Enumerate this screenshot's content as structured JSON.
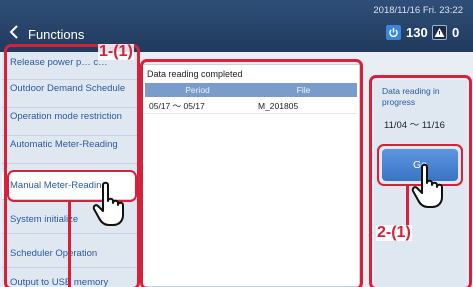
{
  "header": {
    "title": "Functions",
    "datetime": "2018/11/16 Fri. 23:22",
    "stats": [
      {
        "icon": "power-icon",
        "value": "130"
      },
      {
        "icon": "warning-icon",
        "value": "0"
      }
    ]
  },
  "sidebar": {
    "items": [
      {
        "label": "Release power p… c…"
      },
      {
        "label": "Outdoor Demand Schedule"
      },
      {
        "label": "Operation mode restriction"
      },
      {
        "label": "Automatic Meter-Reading"
      },
      {
        "label": "Manual Meter-Reading"
      },
      {
        "label": "System initialize"
      },
      {
        "label": "Scheduler Operation"
      },
      {
        "label": "Output to USB memory"
      }
    ]
  },
  "main": {
    "status": "Data reading completed",
    "columns": [
      "Period",
      "File"
    ],
    "rows": [
      {
        "period": "05/17 ～ 05/17",
        "file": "M_201805"
      }
    ]
  },
  "right_panel": {
    "status": "Data reading in progress",
    "period": "11/04 ～ 11/16",
    "go_label": "Go"
  },
  "annotations": {
    "label_1": "1-(1)",
    "label_2": "2-(1)"
  },
  "colors": {
    "annotation": "#d7203a",
    "header": "#2f4f78",
    "accent": "#3a73c2"
  }
}
